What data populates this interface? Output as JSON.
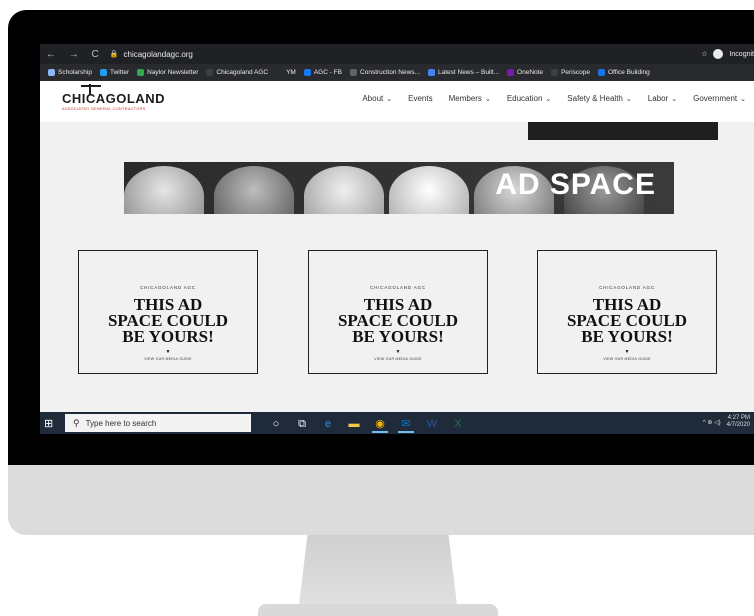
{
  "browser": {
    "nav_symbols": "← → C",
    "lock": "🔒",
    "url": "chicagolandagc.org",
    "right_star": "☆",
    "profile_label": "Incognit"
  },
  "bookmarks": [
    {
      "label": "Scholarship",
      "color": "#8ab4f8"
    },
    {
      "label": "Twitter",
      "color": "#1da1f2"
    },
    {
      "label": "Naylor Newsletter",
      "color": "#34a853"
    },
    {
      "label": "Chicagoland AGC",
      "color": "#3c4043"
    },
    {
      "label": "YM",
      "color": "#292a2d"
    },
    {
      "label": "AGC - FB",
      "color": "#1877f2"
    },
    {
      "label": "Construction News...",
      "color": "#5f6368"
    },
    {
      "label": "Latest News – Built...",
      "color": "#4285f4"
    },
    {
      "label": "OneNote",
      "color": "#7719aa"
    },
    {
      "label": "Periscope",
      "color": "#3c4043"
    },
    {
      "label": "Office Building",
      "color": "#1a73e8"
    }
  ],
  "site": {
    "logo": "CHICAGOLAND",
    "logo_sub": "ASSOCIATED GENERAL CONTRACTORS",
    "nav": [
      {
        "label": "About",
        "chevron": "⌄"
      },
      {
        "label": "Events",
        "chevron": ""
      },
      {
        "label": "Members",
        "chevron": "⌄"
      },
      {
        "label": "Education",
        "chevron": "⌄"
      },
      {
        "label": "Safety & Health",
        "chevron": "⌄"
      },
      {
        "label": "Labor",
        "chevron": "⌄"
      },
      {
        "label": "Government",
        "chevron": "⌄"
      }
    ]
  },
  "banner": {
    "text": "AD SPACE"
  },
  "ad_boxes": [
    {
      "kicker": "CHICAGOLAND AGC",
      "line1": "THIS AD",
      "line2": "SPACE COULD",
      "line3": "BE YOURS!",
      "marker": "▼",
      "guide": "VIEW OUR MEDIA GUIDE"
    },
    {
      "kicker": "CHICAGOLAND AGC",
      "line1": "THIS AD",
      "line2": "SPACE COULD",
      "line3": "BE YOURS!",
      "marker": "▼",
      "guide": "VIEW OUR MEDIA GUIDE"
    },
    {
      "kicker": "CHICAGOLAND AGC",
      "line1": "THIS AD",
      "line2": "SPACE COULD",
      "line3": "BE YOURS!",
      "marker": "▼",
      "guide": "VIEW OUR MEDIA GUIDE"
    }
  ],
  "taskbar": {
    "start_icon": "⊞",
    "search_icon": "⚲",
    "search_placeholder": "Type here to search",
    "apps": [
      {
        "name": "cortana-icon",
        "glyph": "○",
        "color": "#ffffff"
      },
      {
        "name": "task-view-icon",
        "glyph": "⧉",
        "color": "#ffffff"
      },
      {
        "name": "edge-icon",
        "glyph": "e",
        "color": "#2f8fe0"
      },
      {
        "name": "file-explorer-icon",
        "glyph": "▬",
        "color": "#f7c948"
      },
      {
        "name": "chrome-icon",
        "glyph": "◉",
        "color": "#f4b400"
      },
      {
        "name": "outlook-icon",
        "glyph": "✉",
        "color": "#0078d4"
      },
      {
        "name": "word-icon",
        "glyph": "W",
        "color": "#2b579a"
      },
      {
        "name": "excel-icon",
        "glyph": "X",
        "color": "#217346"
      }
    ],
    "tray": "^  ⊕  ◁)",
    "time": "4:27 PM",
    "date": "4/7/2020"
  }
}
